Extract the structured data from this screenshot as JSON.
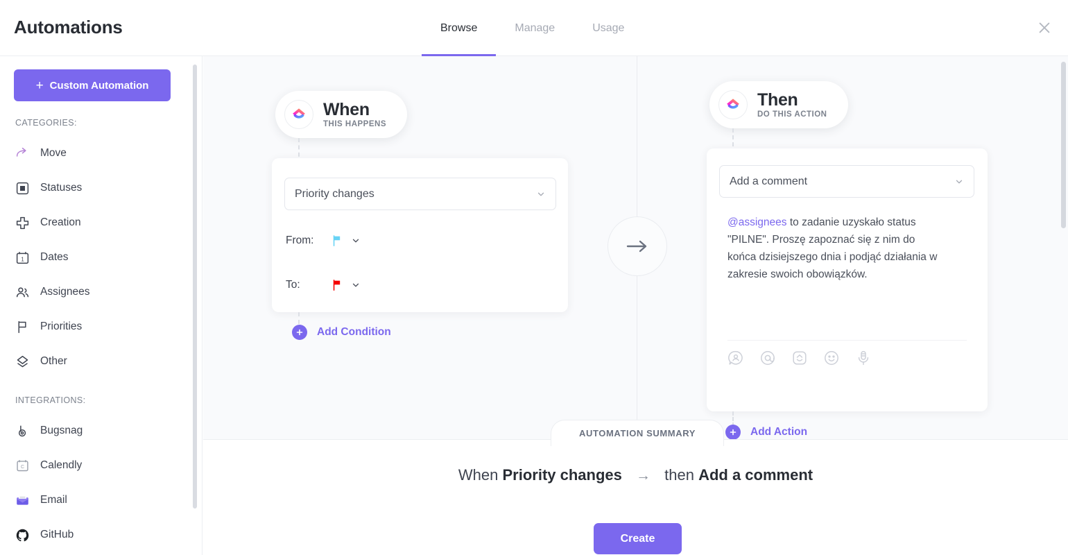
{
  "header": {
    "title": "Automations",
    "tabs": [
      {
        "label": "Browse",
        "active": true
      },
      {
        "label": "Manage",
        "active": false
      },
      {
        "label": "Usage",
        "active": false
      }
    ],
    "close_icon": "close-icon"
  },
  "sidebar": {
    "custom_automation_button": "Custom Automation",
    "plus_glyph": "+",
    "categories_label": "CATEGORIES:",
    "integrations_label": "INTEGRATIONS:",
    "categories": [
      {
        "label": "Move",
        "icon": "move-arrow-icon"
      },
      {
        "label": "Statuses",
        "icon": "status-square-icon"
      },
      {
        "label": "Creation",
        "icon": "plus-cross-icon"
      },
      {
        "label": "Dates",
        "icon": "calendar-icon"
      },
      {
        "label": "Assignees",
        "icon": "people-icon"
      },
      {
        "label": "Priorities",
        "icon": "flag-icon"
      },
      {
        "label": "Other",
        "icon": "layers-icon"
      }
    ],
    "integrations": [
      {
        "label": "Bugsnag",
        "icon": "bugsnag-icon"
      },
      {
        "label": "Calendly",
        "icon": "calendly-icon"
      },
      {
        "label": "Email",
        "icon": "email-envelope-icon"
      },
      {
        "label": "GitHub",
        "icon": "github-icon"
      }
    ]
  },
  "builder": {
    "when": {
      "pill_title": "When",
      "pill_subtitle": "THIS HAPPENS",
      "logo_icon": "clickup-logo-icon",
      "trigger_value": "Priority changes",
      "conditions": [
        {
          "label": "From:",
          "flag_color": "#67d3f5",
          "flag_icon": "priority-flag-low-icon"
        },
        {
          "label": "To:",
          "flag_color": "#f50000",
          "flag_icon": "priority-flag-urgent-icon"
        }
      ],
      "add_condition_label": "Add Condition"
    },
    "connector_icon": "arrow-right-icon",
    "then": {
      "pill_title": "Then",
      "pill_subtitle": "DO THIS ACTION",
      "logo_icon": "clickup-logo-icon",
      "action_value": "Add a comment",
      "comment_mention": "@assignees",
      "comment_text": " to zadanie uzyskało status \"PILNE\". Proszę zapoznać się z nim do końca dzisiejszego dnia i podjąć działania w zakresie swoich obowiązków.",
      "toolbar_icons": [
        "assign-comment-icon",
        "mention-at-icon",
        "task-reference-icon",
        "emoji-smiley-icon",
        "microphone-icon"
      ],
      "add_action_label": "Add Action"
    }
  },
  "summary": {
    "tab_label": "AUTOMATION SUMMARY",
    "when_word": "When",
    "trigger": "Priority changes",
    "arrow": "→",
    "then_word": "then",
    "action": "Add a comment",
    "create_button": "Create"
  },
  "colors": {
    "accent": "#7b68ee",
    "canvas_bg": "#f9fafc",
    "text_primary": "#292d34",
    "text_muted": "#a6aab4"
  }
}
